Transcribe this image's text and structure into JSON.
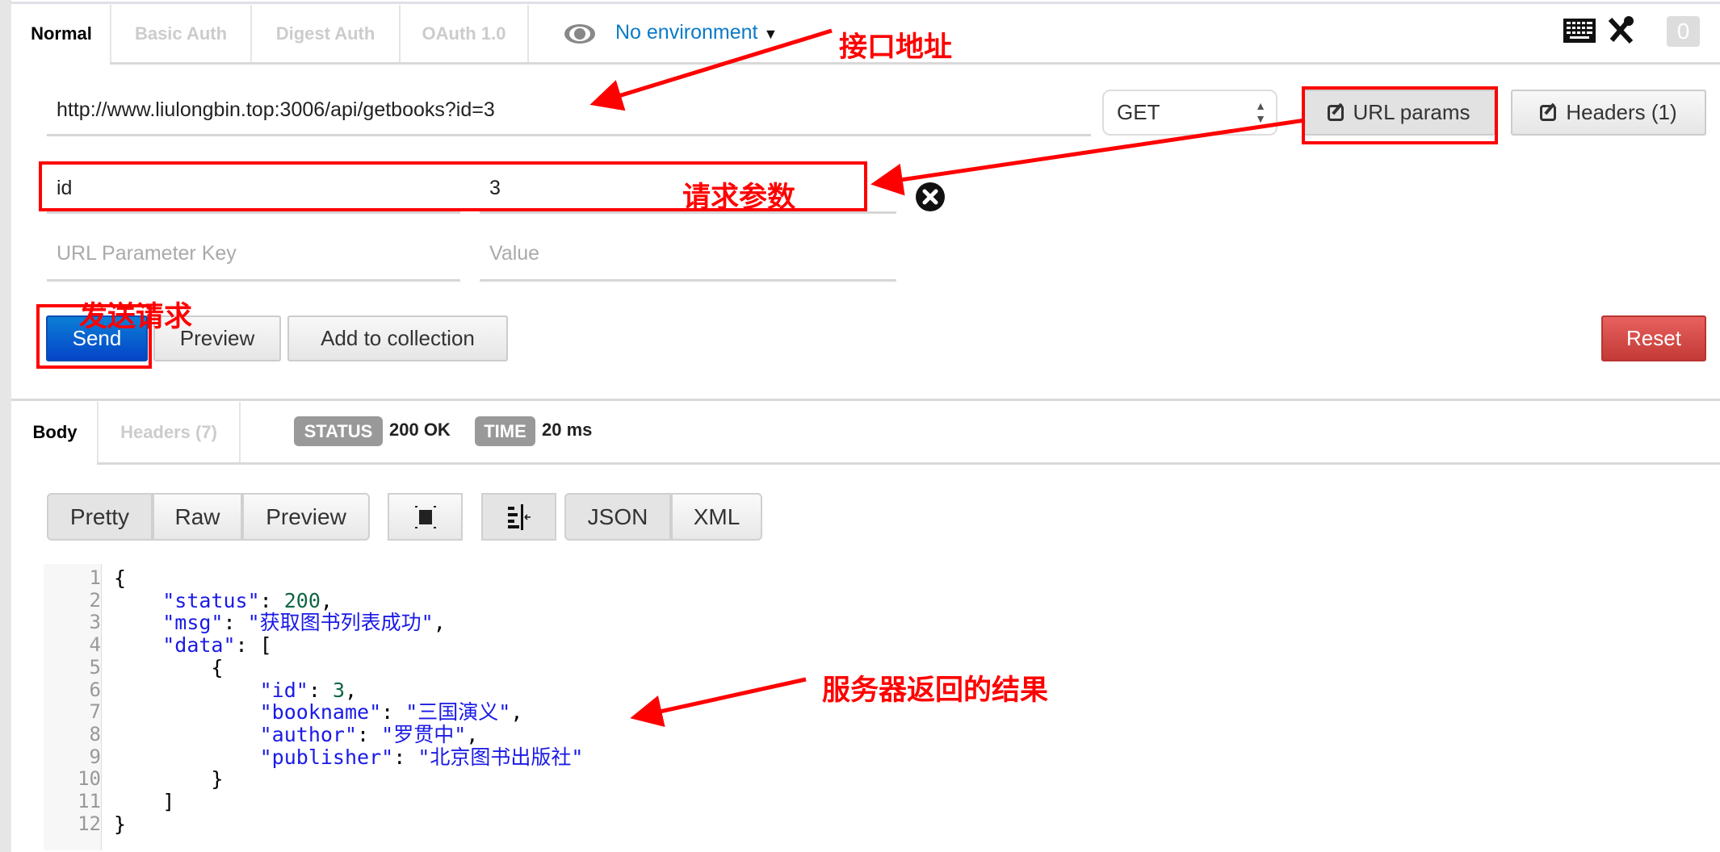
{
  "auth_tabs": [
    {
      "label": "Normal",
      "active": true
    },
    {
      "label": "Basic Auth",
      "active": false
    },
    {
      "label": "Digest Auth",
      "active": false
    },
    {
      "label": "OAuth 1.0",
      "active": false
    }
  ],
  "environment": {
    "label": "No environment",
    "icon": "eye-icon"
  },
  "toolbar_icons": [
    "keyboard-icon",
    "wrench-icon"
  ],
  "counter_badge": "0",
  "request": {
    "url": "http://www.liulongbin.top:3006/api/getbooks?id=3",
    "method": "GET",
    "url_params_label": "URL params",
    "headers_label": "Headers (1)",
    "params": [
      {
        "key": "id",
        "value": "3"
      }
    ],
    "key_placeholder": "URL Parameter Key",
    "value_placeholder": "Value"
  },
  "actions": {
    "send": "Send",
    "preview": "Preview",
    "add_to_collection": "Add to collection",
    "reset": "Reset"
  },
  "response": {
    "tabs": [
      {
        "label": "Body",
        "active": true
      },
      {
        "label": "Headers (7)",
        "active": false
      }
    ],
    "status_label": "STATUS",
    "status_value": "200 OK",
    "time_label": "TIME",
    "time_value": "20 ms",
    "view_modes": [
      "Pretty",
      "Raw",
      "Preview"
    ],
    "formats": [
      "JSON",
      "XML"
    ],
    "code_lines": [
      [
        [
          "p",
          "{"
        ]
      ],
      [
        [
          "p",
          "    "
        ],
        [
          "k",
          "\"status\""
        ],
        [
          "p",
          ": "
        ],
        [
          "n",
          "200"
        ],
        [
          "p",
          ","
        ]
      ],
      [
        [
          "p",
          "    "
        ],
        [
          "k",
          "\"msg\""
        ],
        [
          "p",
          ": "
        ],
        [
          "s",
          "\"获取图书列表成功\""
        ],
        [
          "p",
          ","
        ]
      ],
      [
        [
          "p",
          "    "
        ],
        [
          "k",
          "\"data\""
        ],
        [
          "p",
          ": ["
        ]
      ],
      [
        [
          "p",
          "        {"
        ]
      ],
      [
        [
          "p",
          "            "
        ],
        [
          "k",
          "\"id\""
        ],
        [
          "p",
          ": "
        ],
        [
          "n",
          "3"
        ],
        [
          "p",
          ","
        ]
      ],
      [
        [
          "p",
          "            "
        ],
        [
          "k",
          "\"bookname\""
        ],
        [
          "p",
          ": "
        ],
        [
          "s",
          "\"三国演义\""
        ],
        [
          "p",
          ","
        ]
      ],
      [
        [
          "p",
          "            "
        ],
        [
          "k",
          "\"author\""
        ],
        [
          "p",
          ": "
        ],
        [
          "s",
          "\"罗贯中\""
        ],
        [
          "p",
          ","
        ]
      ],
      [
        [
          "p",
          "            "
        ],
        [
          "k",
          "\"publisher\""
        ],
        [
          "p",
          ": "
        ],
        [
          "s",
          "\"北京图书出版社\""
        ]
      ],
      [
        [
          "p",
          "        }"
        ]
      ],
      [
        [
          "p",
          "    ]"
        ]
      ],
      [
        [
          "p",
          "}"
        ]
      ]
    ]
  },
  "annotations": {
    "url": "接口地址",
    "params": "请求参数",
    "send": "发送请求",
    "result": "服务器返回的结果",
    "color": "#ff0000"
  }
}
